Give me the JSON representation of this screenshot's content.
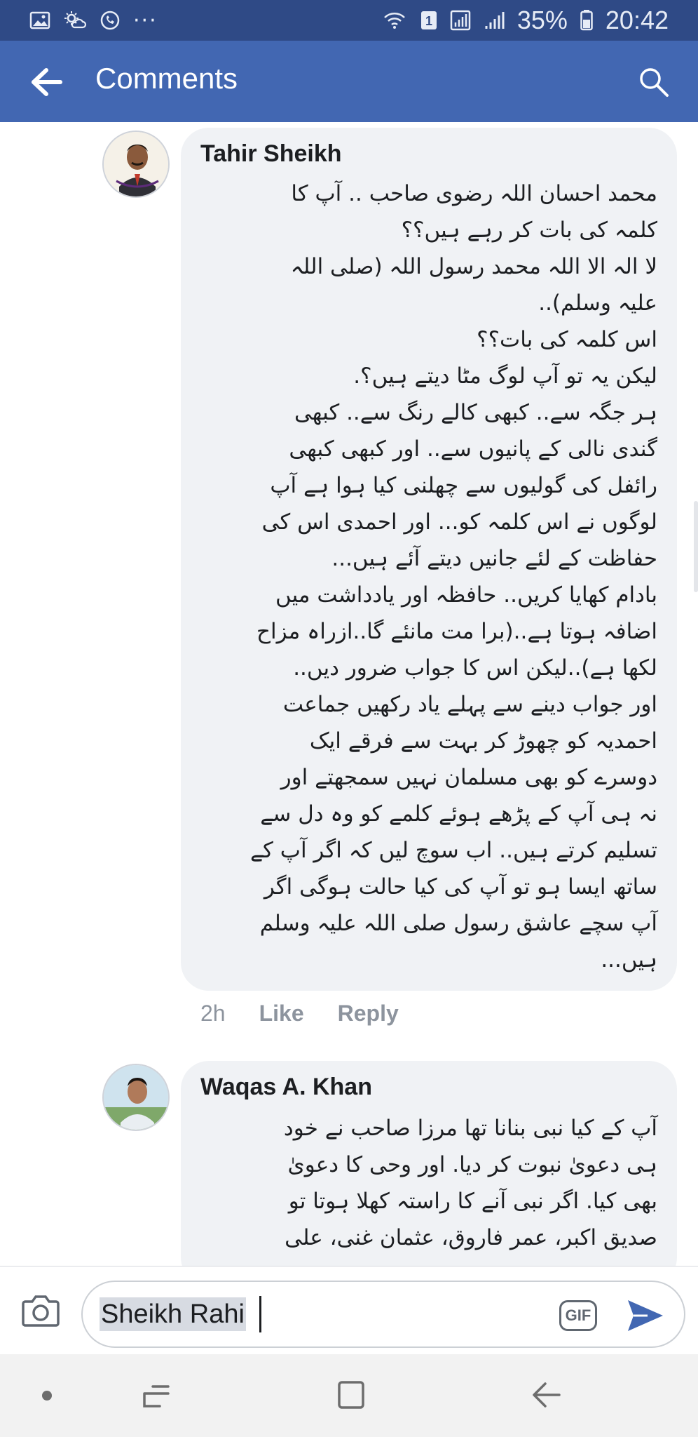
{
  "status_bar": {
    "battery_percent": "35%",
    "time": "20:42",
    "sim_badge": "1",
    "more_dots": "···"
  },
  "header": {
    "title": "Comments"
  },
  "comments": [
    {
      "author": "Tahir Sheikh",
      "text": "محمد احسان اللہ رضوی صاحب .. آپ کا\nکلمہ کی بات کر رہے ہیں؟؟\nلا الہ الا اللہ محمد رسول اللہ (صلی اللہ\nعلیہ وسلم)..\nاس کلمہ کی بات؟؟\nلیکن یہ تو آپ لوگ مٹا دیتے ہیں؟.\nہر جگہ سے.. کبھی کالے رنگ سے.. کبھی\nگندی نالی کے پانیوں سے.. اور کبھی کبھی\nرائفل کی گولیوں سے چھلنی کیا ہوا ہے آپ\nلوگوں نے اس کلمہ کو... اور احمدی اس کی\nحفاظت کے لئے جانیں دیتے آئے ہیں...\nبادام کھایا کریں.. حافظہ اور یادداشت میں\nاضافہ ہوتا ہے..(برا مت مانئے گا..ازراہ مزاح\nلکھا ہے)..لیکن اس کا جواب ضرور دیں..\nاور جواب دینے سے پہلے یاد رکھیں جماعت\nاحمدیہ کو چھوڑ کر بہت سے فرقے ایک\nدوسرے کو بھی مسلمان نہیں سمجھتے اور\nنہ ہی آپ کے پڑھے ہوئے کلمے کو وہ دل سے\nتسلیم کرتے ہیں.. اب سوچ لیں کہ اگر آپ کے\nساتھ ایسا ہو تو آپ کی کیا حالت ہوگی اگر\nآپ سچے عاشق رسول صلی اللہ علیہ وسلم\nہیں...",
      "time": "2h",
      "like_label": "Like",
      "reply_label": "Reply"
    },
    {
      "author": "Waqas A. Khan",
      "text": "آپ کے کیا نبی بنانا تھا مرزا صاحب نے خود\nہی دعویٰ نبوت کر دیا. اور وحی کا دعویٰ\nبھی کیا. اگر نبی آنے کا راستہ کھلا ہوتا تو\nصدیق اکبر، عمر فاروق، عثمان غنی، علی"
    }
  ],
  "composer": {
    "value": "Sheikh Rahi",
    "gif_label": "GIF"
  },
  "colors": {
    "status_bar": "#2f4a86",
    "app_bar": "#4267b2",
    "bubble": "#f0f2f5",
    "send": "#4267b2"
  }
}
